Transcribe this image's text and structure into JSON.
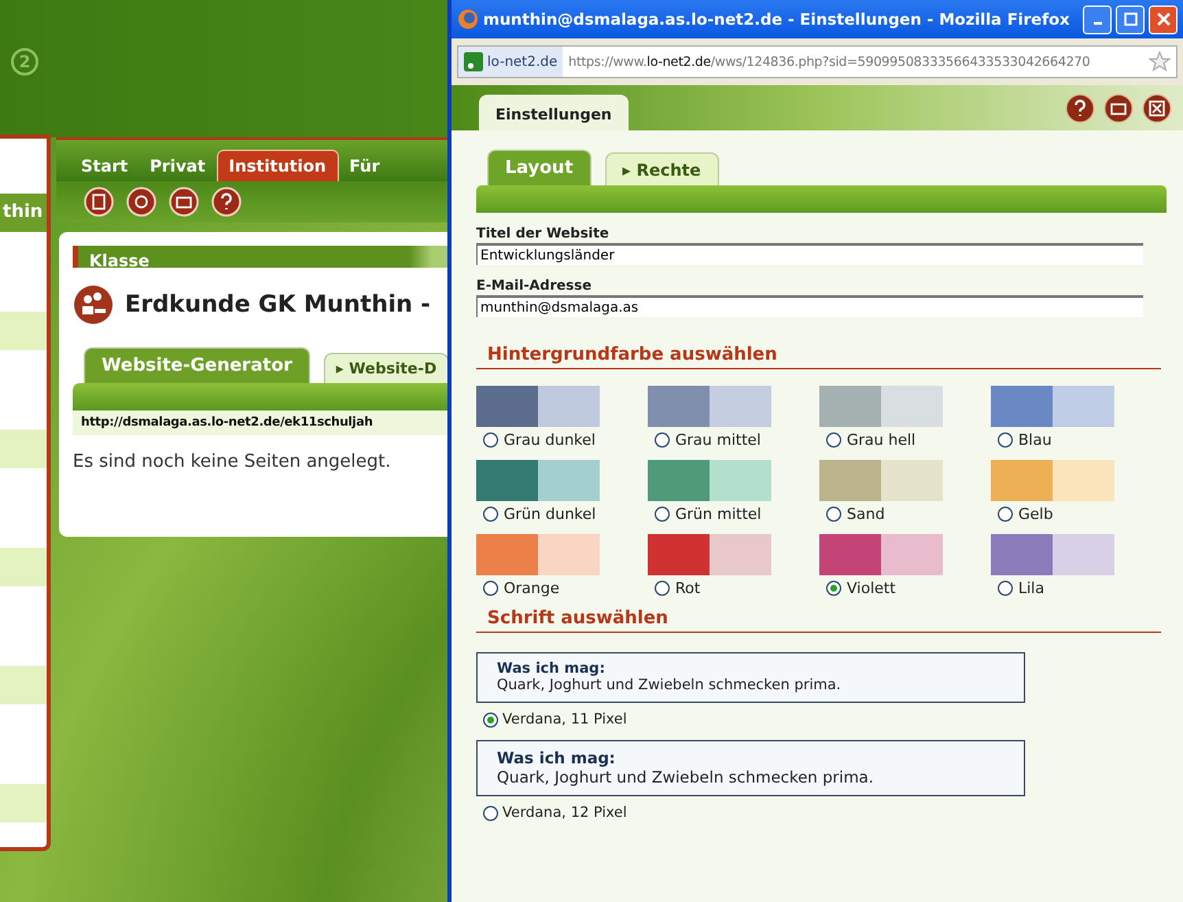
{
  "background_page": {
    "logo_mark": "2",
    "sidebar_tab": "thin",
    "nav_tabs": [
      {
        "label": "Start",
        "selected": false
      },
      {
        "label": "Privat",
        "selected": false
      },
      {
        "label": "Institution",
        "selected": true
      },
      {
        "label": "Für",
        "selected": false
      }
    ],
    "card": {
      "header": "Klasse",
      "title": "Erdkunde GK Munthin -",
      "tabs": [
        {
          "label": "Website-Generator",
          "selected": true
        },
        {
          "label": "▸ Website-D",
          "selected": false
        }
      ],
      "url": "http://dsmalaga.as.lo-net2.de/ek11schuljah",
      "message": "Es sind noch keine Seiten angelegt."
    }
  },
  "popup": {
    "title": "munthin@dsmalaga.as.lo-net2.de - Einstellungen - Mozilla Firefox",
    "site_badge": "lo-net2.de",
    "url": {
      "prefix": "https://www.",
      "host": "lo-net2.de",
      "rest": "/wws/124836.php?sid=59099508333566433533042664270"
    },
    "header_tab": "Einstellungen",
    "tabs": [
      {
        "label": "Layout",
        "selected": true
      },
      {
        "label": "▸ Rechte",
        "selected": false
      }
    ],
    "fields": [
      {
        "label": "Titel der Website",
        "value": "Entwicklungsländer"
      },
      {
        "label": "E-Mail-Adresse",
        "value": "munthin@dsmalaga.as"
      }
    ],
    "color_section": {
      "heading": "Hintergrundfarbe auswählen",
      "options": [
        {
          "label": "Grau dunkel",
          "swatch": [
            {
              "color": "#5d6d8e"
            },
            {
              "color": "#c0cadf"
            }
          ],
          "selected": false
        },
        {
          "label": "Grau mittel",
          "swatch": [
            {
              "color": "#7f8fad"
            },
            {
              "color": "#c5cde0"
            }
          ],
          "selected": false
        },
        {
          "label": "Grau hell",
          "swatch": [
            {
              "color": "#a5b0b0"
            },
            {
              "color": "#d9dfe0"
            }
          ],
          "selected": false
        },
        {
          "label": "Blau",
          "swatch": [
            {
              "color": "#6a89c4"
            },
            {
              "color": "#c0cde6"
            }
          ],
          "selected": false
        },
        {
          "label": "Grün dunkel",
          "swatch": [
            {
              "color": "#337a73"
            },
            {
              "color": "#a3d0cf"
            }
          ],
          "selected": false
        },
        {
          "label": "Grün mittel",
          "swatch": [
            {
              "color": "#4f9a79"
            },
            {
              "color": "#b3e0cc"
            }
          ],
          "selected": false
        },
        {
          "label": "Sand",
          "swatch": [
            {
              "color": "#bbb38b"
            },
            {
              "color": "#e6e3cc"
            }
          ],
          "selected": false
        },
        {
          "label": "Gelb",
          "swatch": [
            {
              "color": "#eeb055"
            },
            {
              "color": "#fbe3bc"
            }
          ],
          "selected": false
        },
        {
          "label": "Orange",
          "swatch": [
            {
              "color": "#eb8049"
            },
            {
              "color": "#f8d6c3"
            }
          ],
          "selected": false
        },
        {
          "label": "Rot",
          "swatch": [
            {
              "color": "#d03232"
            },
            {
              "color": "#e8c8c8"
            }
          ],
          "selected": false
        },
        {
          "label": "Violett",
          "swatch": [
            {
              "color": "#c44478"
            },
            {
              "color": "#e8bccd"
            }
          ],
          "selected": true
        },
        {
          "label": "Lila",
          "swatch": [
            {
              "color": "#8c7cbc"
            },
            {
              "color": "#d8d0e6"
            }
          ],
          "selected": false
        }
      ]
    },
    "font_section": {
      "heading": "Schrift auswählen",
      "options": [
        {
          "preview_heading": "Was ich mag:",
          "preview_text": "Quark, Joghurt und Zwiebeln schmecken prima.",
          "label": "Verdana, 11 Pixel",
          "selected": true
        },
        {
          "preview_heading": "Was ich mag:",
          "preview_text": "Quark, Joghurt und Zwiebeln schmecken prima.",
          "label": "Verdana, 12 Pixel",
          "selected": false
        }
      ]
    }
  }
}
